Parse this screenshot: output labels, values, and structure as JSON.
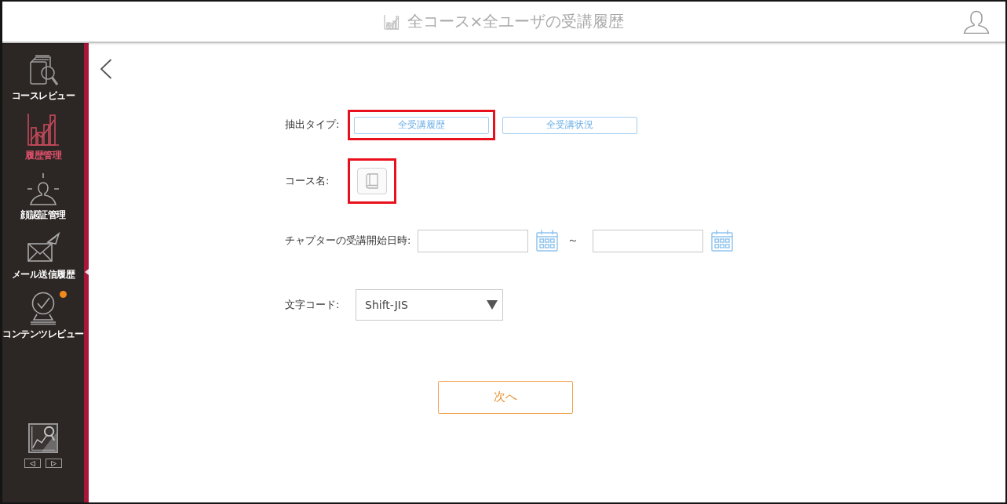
{
  "window": {
    "title": "全コース×全ユーザの受講履歴"
  },
  "sidebar": {
    "items": [
      {
        "label": "コースレビュー",
        "selected": false,
        "notification": false
      },
      {
        "label": "履歴管理",
        "selected": true,
        "notification": false
      },
      {
        "label": "顔認証管理",
        "selected": false,
        "notification": false
      },
      {
        "label": "メール送信履歴",
        "selected": false,
        "notification": false
      },
      {
        "label": "コンテンツレビュー",
        "selected": false,
        "notification": true
      }
    ]
  },
  "form": {
    "extract_type": {
      "label": "抽出タイプ:",
      "options": [
        {
          "label": "全受講履歴",
          "highlighted": true
        },
        {
          "label": "全受講状況",
          "highlighted": false
        }
      ]
    },
    "course": {
      "label": "コース名:",
      "highlighted": true
    },
    "start_date": {
      "label": "チャプターの受講開始日時:",
      "separator": "～"
    },
    "encoding": {
      "label": "文字コード:",
      "value": "Shift-JIS"
    },
    "next_button": {
      "label": "次へ"
    }
  }
}
